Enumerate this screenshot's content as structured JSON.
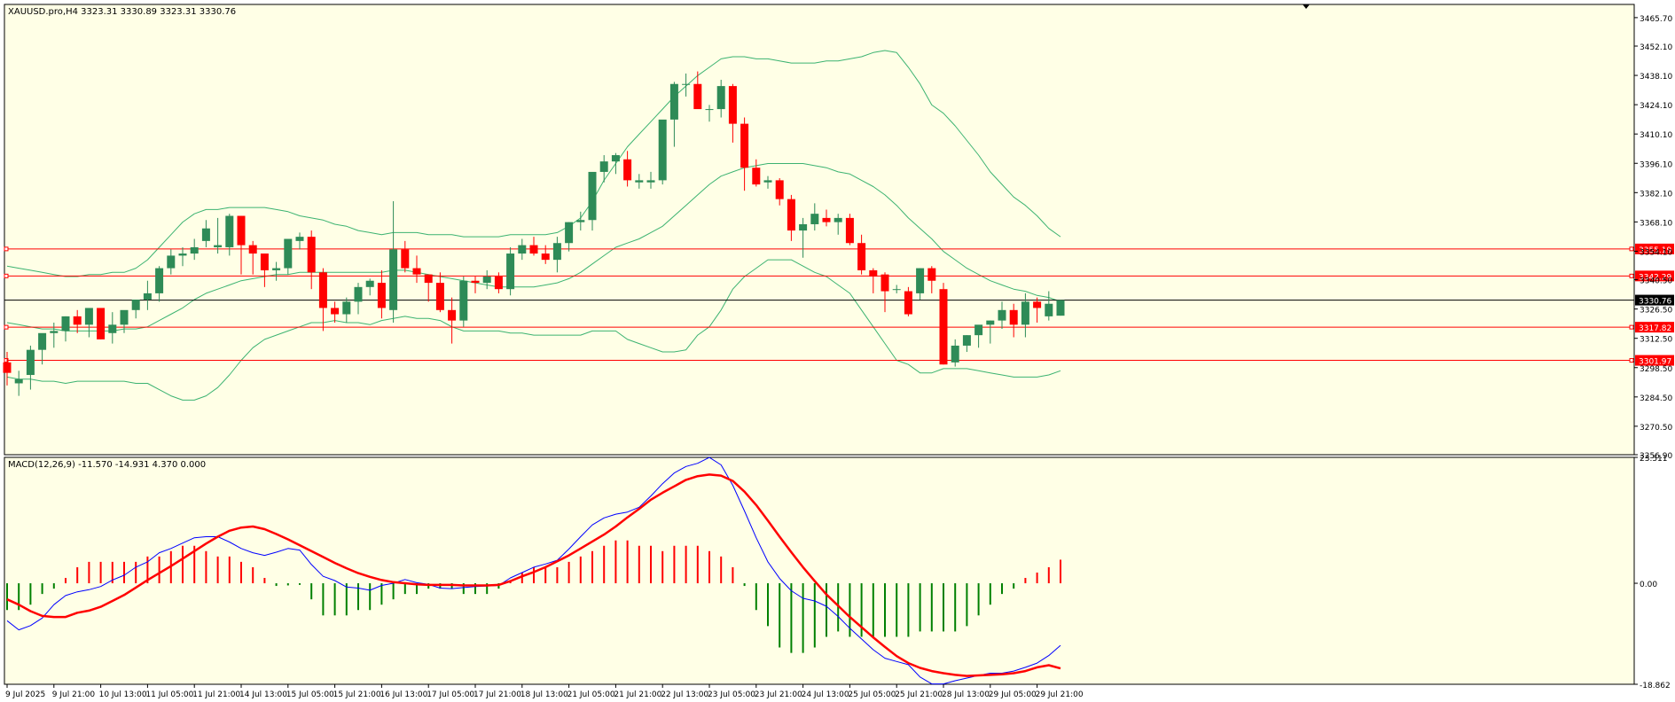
{
  "header": {
    "symbol_line": "XAUUSD.pro,H4  3323.31 3330.89 3323.31 3330.76",
    "macd_line": "MACD(12,26,9) -11.570 -14.931 4.370 0.000"
  },
  "colors": {
    "background": "#ffffe6",
    "bull": "#2e8b57",
    "bear": "#ff0000",
    "bands": "#3cb371",
    "level_line": "#ff0000",
    "current_price_line": "#000000",
    "macd_line": "#0000ff",
    "signal_line": "#ff0000"
  },
  "chart_data": [
    {
      "type": "candlestick",
      "title": "XAUUSD.pro,H4",
      "ylim": [
        3256.9,
        3472.0
      ],
      "y_ticks": [
        "3465.70",
        "3452.10",
        "3438.10",
        "3424.10",
        "3410.10",
        "3396.10",
        "3382.10",
        "3368.10",
        "3354.10",
        "3340.50",
        "3326.50",
        "3312.50",
        "3298.50",
        "3284.50",
        "3270.50",
        "3256.90"
      ],
      "x_ticks": [
        {
          "label": "9 Jul 2025",
          "bar": 0
        },
        {
          "label": "9 Jul 21:00",
          "bar": 4
        },
        {
          "label": "10 Jul 13:00",
          "bar": 8
        },
        {
          "label": "11 Jul 05:00",
          "bar": 12
        },
        {
          "label": "11 Jul 21:00",
          "bar": 16
        },
        {
          "label": "14 Jul 13:00",
          "bar": 20
        },
        {
          "label": "15 Jul 05:00",
          "bar": 24
        },
        {
          "label": "15 Jul 21:00",
          "bar": 28
        },
        {
          "label": "16 Jul 13:00",
          "bar": 32
        },
        {
          "label": "17 Jul 05:00",
          "bar": 36
        },
        {
          "label": "17 Jul 21:00",
          "bar": 40
        },
        {
          "label": "18 Jul 13:00",
          "bar": 44
        },
        {
          "label": "21 Jul 05:00",
          "bar": 48
        },
        {
          "label": "21 Jul 21:00",
          "bar": 52
        },
        {
          "label": "22 Jul 13:00",
          "bar": 56
        },
        {
          "label": "23 Jul 05:00",
          "bar": 60
        },
        {
          "label": "23 Jul 21:00",
          "bar": 64
        },
        {
          "label": "24 Jul 13:00",
          "bar": 68
        },
        {
          "label": "25 Jul 05:00",
          "bar": 72
        },
        {
          "label": "25 Jul 21:00",
          "bar": 76
        },
        {
          "label": "28 Jul 13:00",
          "bar": 80
        },
        {
          "label": "29 Jul 05:00",
          "bar": 84
        },
        {
          "label": "29 Jul 21:00",
          "bar": 88
        }
      ],
      "ohlc": [
        [
          3301,
          3306,
          3290,
          3296
        ],
        [
          3291,
          3297,
          3285,
          3293
        ],
        [
          3295,
          3309,
          3288,
          3307
        ],
        [
          3307,
          3314,
          3300,
          3315
        ],
        [
          3315,
          3320,
          3308,
          3316
        ],
        [
          3316,
          3323,
          3311,
          3323
        ],
        [
          3323,
          3326,
          3315,
          3319
        ],
        [
          3319,
          3326,
          3313,
          3327
        ],
        [
          3327,
          3325,
          3312,
          3312
        ],
        [
          3315,
          3325,
          3310,
          3319
        ],
        [
          3319,
          3325,
          3315,
          3326
        ],
        [
          3326,
          3331,
          3322,
          3331
        ],
        [
          3331,
          3340,
          3326,
          3334
        ],
        [
          3334,
          3347,
          3330,
          3346
        ],
        [
          3346,
          3355,
          3343,
          3352
        ],
        [
          3352,
          3356,
          3347,
          3353
        ],
        [
          3353,
          3360,
          3350,
          3356
        ],
        [
          3359,
          3369,
          3356,
          3365
        ],
        [
          3356,
          3370,
          3353,
          3357
        ],
        [
          3356,
          3372,
          3352,
          3371
        ],
        [
          3371,
          3371,
          3343,
          3357
        ],
        [
          3357,
          3359,
          3343,
          3353
        ],
        [
          3353,
          3353,
          3337,
          3345
        ],
        [
          3345,
          3349,
          3340,
          3346
        ],
        [
          3346,
          3359,
          3343,
          3360
        ],
        [
          3359,
          3363,
          3355,
          3361
        ],
        [
          3361,
          3364,
          3336,
          3344
        ],
        [
          3344,
          3346,
          3316,
          3327
        ],
        [
          3327,
          3330,
          3320,
          3324
        ],
        [
          3324,
          3332,
          3320,
          3330
        ],
        [
          3330,
          3339,
          3324,
          3337
        ],
        [
          3337,
          3341,
          3333,
          3340
        ],
        [
          3339,
          3345,
          3322,
          3327
        ],
        [
          3326,
          3378,
          3320,
          3355
        ],
        [
          3355,
          3359,
          3344,
          3346
        ],
        [
          3346,
          3352,
          3339,
          3343
        ],
        [
          3343,
          3343,
          3330,
          3339
        ],
        [
          3339,
          3344,
          3325,
          3326
        ],
        [
          3326,
          3332,
          3310,
          3321
        ],
        [
          3321,
          3342,
          3318,
          3340
        ],
        [
          3340,
          3342,
          3334,
          3339
        ],
        [
          3339,
          3345,
          3336,
          3342
        ],
        [
          3342,
          3344,
          3334,
          3336
        ],
        [
          3336,
          3356,
          3333,
          3353
        ],
        [
          3353,
          3360,
          3350,
          3357
        ],
        [
          3357,
          3361,
          3352,
          3353
        ],
        [
          3353,
          3357,
          3348,
          3350
        ],
        [
          3350,
          3361,
          3344,
          3358
        ],
        [
          3358,
          3368,
          3354,
          3368
        ],
        [
          3368,
          3373,
          3364,
          3369
        ],
        [
          3369,
          3391,
          3364,
          3392
        ],
        [
          3392,
          3400,
          3387,
          3397
        ],
        [
          3397,
          3401,
          3391,
          3400
        ],
        [
          3398,
          3402,
          3385,
          3388
        ],
        [
          3387,
          3391,
          3384,
          3388
        ],
        [
          3387,
          3392,
          3384,
          3388
        ],
        [
          3388,
          3412,
          3386,
          3417
        ],
        [
          3417,
          3435,
          3404,
          3434
        ],
        [
          3434,
          3439,
          3428,
          3434
        ],
        [
          3434,
          3440,
          3423,
          3422
        ],
        [
          3422,
          3424,
          3416,
          3422
        ],
        [
          3422,
          3436,
          3418,
          3433
        ],
        [
          3433,
          3434,
          3406,
          3415
        ],
        [
          3415,
          3418,
          3383,
          3394
        ],
        [
          3394,
          3398,
          3385,
          3386
        ],
        [
          3387,
          3390,
          3384,
          3388
        ],
        [
          3388,
          3389,
          3376,
          3379
        ],
        [
          3379,
          3381,
          3359,
          3364
        ],
        [
          3364,
          3370,
          3351,
          3367
        ],
        [
          3367,
          3377,
          3364,
          3372
        ],
        [
          3370,
          3374,
          3366,
          3368
        ],
        [
          3368,
          3372,
          3362,
          3370
        ],
        [
          3370,
          3372,
          3357,
          3358
        ],
        [
          3358,
          3362,
          3343,
          3345
        ],
        [
          3345,
          3346,
          3334,
          3342
        ],
        [
          3343,
          3344,
          3325,
          3335
        ],
        [
          3336,
          3338,
          3334,
          3336
        ],
        [
          3335,
          3337,
          3323,
          3324
        ],
        [
          3334,
          3346,
          3331,
          3346
        ],
        [
          3346,
          3347,
          3334,
          3340
        ],
        [
          3336,
          3339,
          3300,
          3300
        ],
        [
          3301,
          3312,
          3299,
          3309
        ],
        [
          3309,
          3314,
          3306,
          3314
        ],
        [
          3314,
          3318,
          3308,
          3319
        ],
        [
          3319,
          3321,
          3310,
          3321
        ],
        [
          3321,
          3330,
          3317,
          3326
        ],
        [
          3326,
          3329,
          3313,
          3319
        ],
        [
          3319,
          3334,
          3313,
          3330
        ],
        [
          3330,
          3332,
          3320,
          3327
        ],
        [
          3323,
          3335,
          3321,
          3329
        ],
        [
          3323.31,
          3330.89,
          3323.31,
          3330.76
        ]
      ],
      "bollinger_upper": [
        3347,
        3346,
        3345,
        3344,
        3343,
        3342,
        3342,
        3343,
        3343,
        3344,
        3344,
        3346,
        3350,
        3356,
        3362,
        3368,
        3372,
        3374,
        3374,
        3375,
        3375,
        3375,
        3375,
        3374,
        3373,
        3371,
        3370,
        3369,
        3367,
        3366,
        3364,
        3363,
        3362,
        3363,
        3363,
        3363,
        3362,
        3362,
        3362,
        3361,
        3361,
        3361,
        3361,
        3362,
        3362,
        3362,
        3362,
        3363,
        3366,
        3370,
        3378,
        3388,
        3396,
        3404,
        3410,
        3416,
        3422,
        3428,
        3433,
        3438,
        3442,
        3446,
        3447,
        3447,
        3446,
        3446,
        3445,
        3444,
        3444,
        3444,
        3445,
        3445,
        3446,
        3447,
        3449,
        3450,
        3449,
        3442,
        3434,
        3424,
        3420,
        3414,
        3407,
        3400,
        3392,
        3386,
        3380,
        3376,
        3371,
        3365,
        3361
      ],
      "bollinger_middle": [
        3320,
        3319,
        3318,
        3317,
        3317,
        3316,
        3316,
        3316,
        3316,
        3316,
        3317,
        3317,
        3318,
        3321,
        3324,
        3327,
        3331,
        3334,
        3336,
        3338,
        3340,
        3341,
        3342,
        3343,
        3343,
        3344,
        3344,
        3344,
        3344,
        3344,
        3344,
        3344,
        3344,
        3345,
        3345,
        3344,
        3343,
        3342,
        3341,
        3340,
        3339,
        3338,
        3337,
        3337,
        3337,
        3337,
        3338,
        3339,
        3341,
        3344,
        3348,
        3352,
        3356,
        3358,
        3360,
        3363,
        3366,
        3371,
        3376,
        3381,
        3386,
        3390,
        3392,
        3394,
        3395,
        3396,
        3396,
        3396,
        3396,
        3395,
        3394,
        3392,
        3391,
        3388,
        3385,
        3381,
        3376,
        3370,
        3365,
        3360,
        3354,
        3350,
        3346,
        3343,
        3340,
        3338,
        3336,
        3335,
        3333,
        3332,
        3330
      ],
      "bollinger_lower": [
        3294,
        3293,
        3293,
        3292,
        3292,
        3291,
        3292,
        3292,
        3292,
        3292,
        3292,
        3291,
        3291,
        3288,
        3285,
        3283,
        3283,
        3285,
        3289,
        3295,
        3302,
        3308,
        3312,
        3314,
        3316,
        3318,
        3320,
        3320,
        3321,
        3320,
        3320,
        3319,
        3321,
        3322,
        3323,
        3322,
        3322,
        3321,
        3318,
        3316,
        3316,
        3316,
        3316,
        3315,
        3315,
        3314,
        3314,
        3314,
        3314,
        3314,
        3316,
        3316,
        3316,
        3312,
        3310,
        3308,
        3306,
        3306,
        3307,
        3314,
        3318,
        3326,
        3336,
        3342,
        3346,
        3350,
        3350,
        3350,
        3347,
        3344,
        3342,
        3338,
        3334,
        3326,
        3318,
        3310,
        3302,
        3300,
        3296,
        3296,
        3298,
        3298,
        3298,
        3297,
        3296,
        3295,
        3294,
        3294,
        3294,
        3295,
        3297
      ],
      "horizontal_levels": [
        {
          "price": 3355.19,
          "label": "3355.19",
          "color": "#ff0000"
        },
        {
          "price": 3342.29,
          "label": "3342.29",
          "color": "#ff0000"
        },
        {
          "price": 3330.76,
          "label": "3330.76",
          "color": "#000000"
        },
        {
          "price": 3317.82,
          "label": "3317.82",
          "color": "#ff0000"
        },
        {
          "price": 3301.97,
          "label": "3301.97",
          "color": "#ff0000"
        }
      ]
    },
    {
      "type": "macd",
      "title": "MACD(12,26,9)",
      "ylim": [
        -18.862,
        23.511
      ],
      "y_ticks": [
        "23.511",
        "0.00",
        "-18.862"
      ],
      "histogram": [
        -5,
        -5,
        -4,
        -2,
        -1,
        1,
        3,
        4,
        4,
        4,
        4,
        4,
        5,
        5,
        6,
        7,
        7,
        6,
        5,
        5,
        4,
        3,
        1,
        -0.5,
        -0.4,
        -0.3,
        -3,
        -6,
        -6,
        -6,
        -5,
        -5,
        -4,
        -3,
        -2,
        -2,
        -1,
        -1,
        -1,
        -2,
        -2,
        -2,
        -1,
        0.5,
        2,
        3,
        3,
        3,
        4,
        5,
        6,
        7,
        8,
        8,
        7,
        7,
        6,
        7,
        7,
        7,
        6,
        5,
        3,
        -0.5,
        -5,
        -8,
        -12,
        -13,
        -13,
        -12,
        -10,
        -9,
        -10,
        -10,
        -10,
        -10,
        -10,
        -10,
        -9,
        -9,
        -9,
        -9,
        -8,
        -6,
        -4,
        -2,
        -1,
        1,
        2,
        3,
        4.4
      ],
      "macd": [
        -7,
        -8.7,
        -7.9,
        -6.5,
        -4,
        -2.3,
        -1.6,
        -1.2,
        -0.6,
        0.6,
        1.5,
        3,
        4,
        5.7,
        6.5,
        7.5,
        8.5,
        8.7,
        8.7,
        7.7,
        6.5,
        5.7,
        5.2,
        5.8,
        6.5,
        6.2,
        3.5,
        1.3,
        0.5,
        -0.7,
        -0.9,
        -1.3,
        -0.4,
        0,
        0.7,
        0.1,
        -0.2,
        -0.9,
        -1,
        -0.8,
        -0.6,
        -0.5,
        -0.4,
        1,
        2,
        3,
        3.6,
        4.3,
        6.4,
        8.7,
        10.9,
        12.2,
        12.9,
        13.3,
        14.2,
        16.3,
        18.6,
        20.6,
        21.8,
        22.4,
        23.5,
        22.1,
        18.3,
        13.5,
        8.5,
        4,
        0.9,
        -1.4,
        -2.8,
        -3.3,
        -4.3,
        -6.2,
        -8.4,
        -10.4,
        -12.4,
        -14,
        -14.6,
        -15.2,
        -17.5,
        -18.8,
        -18.8,
        -18.2,
        -17.7,
        -17.2,
        -16.8,
        -16.8,
        -16.4,
        -15.7,
        -14.9,
        -13.5,
        -11.6
      ],
      "signal": [
        -3,
        -4,
        -5.2,
        -6.1,
        -6.3,
        -6.3,
        -5.5,
        -5.1,
        -4.4,
        -3.3,
        -2.2,
        -0.8,
        0.6,
        1.9,
        3.2,
        4.6,
        6,
        7.4,
        8.7,
        9.8,
        10.4,
        10.6,
        10.1,
        9.2,
        8.2,
        7.1,
        6,
        4.9,
        3.8,
        2.8,
        1.9,
        1.2,
        0.6,
        0.2,
        0,
        -0.2,
        -0.3,
        -0.3,
        -0.3,
        -0.4,
        -0.4,
        -0.4,
        -0.3,
        0.4,
        1.3,
        2.1,
        3,
        4.1,
        5.2,
        6.5,
        7.8,
        9.1,
        10.6,
        12.3,
        13.9,
        15.6,
        16.9,
        18.1,
        19.3,
        20,
        20.3,
        20.1,
        19.1,
        17.1,
        14.6,
        11.7,
        8.7,
        5.8,
        3,
        0.4,
        -2.1,
        -4.2,
        -6.3,
        -8.2,
        -10.1,
        -11.9,
        -13.6,
        -14.9,
        -15.8,
        -16.4,
        -16.8,
        -17.1,
        -17.3,
        -17.2,
        -17.1,
        -17,
        -16.8,
        -16.4,
        -15.7,
        -15.3,
        -15.9
      ]
    }
  ]
}
